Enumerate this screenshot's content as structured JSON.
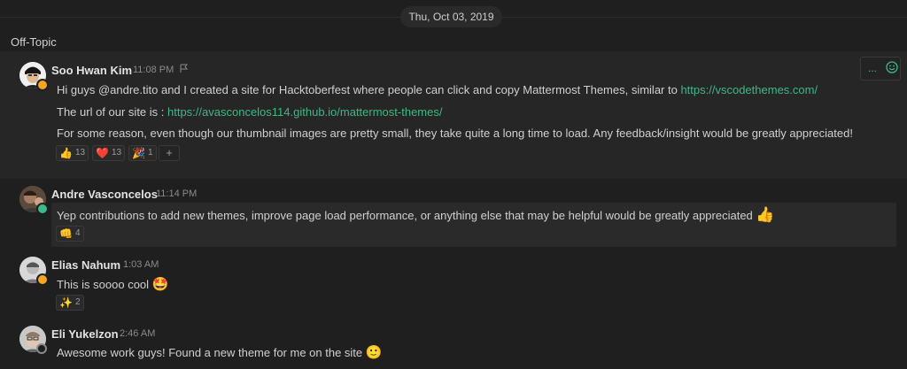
{
  "date_separator": "Thu, Oct 03, 2019",
  "channel": {
    "name": "Off-Topic"
  },
  "hover_actions": {
    "dots": "...",
    "emoji_icon": "smile-icon"
  },
  "posts": [
    {
      "author": "Soo Hwan Kim",
      "time": "11:08 PM",
      "status": "away",
      "lines": [
        {
          "text": "Hi guys @andre.tito and I created a site for Hacktoberfest where people can click and copy Mattermost Themes, similar to ",
          "link": "https://vscodethemes.com/"
        },
        {
          "text": "The url of our site is : ",
          "link": "https://avasconcelos114.github.io/mattermost-themes/"
        },
        {
          "text": "For some reason, even though our thumbnail images are pretty small, they take quite a long time to load. Any feedback/insight would be greatly appreciated!"
        }
      ],
      "reactions": [
        {
          "emoji": "👍",
          "count": "13"
        },
        {
          "emoji": "❤️",
          "count": "13"
        },
        {
          "emoji": "🎉",
          "count": "1"
        }
      ],
      "add_reaction": "+"
    },
    {
      "author": "Andre Vasconcelos",
      "time": "11:14 PM",
      "status": "online",
      "text": "Yep contributions to add new themes, improve page load performance, or anything else that may be helpful would be greatly appreciated",
      "text_emoji": "👍",
      "reactions": [
        {
          "emoji": "👊",
          "count": "4"
        }
      ]
    },
    {
      "author": "Elias Nahum",
      "time": "1:03 AM",
      "status": "away",
      "text": "This is soooo cool",
      "text_emoji": "🤩",
      "reactions": [
        {
          "emoji": "✨",
          "count": "2"
        }
      ]
    },
    {
      "author": "Eli Yukelzon",
      "time": "2:46 AM",
      "status": "offline",
      "text": "Awesome work guys! Found a new theme for me on the site",
      "text_emoji": "🙂"
    }
  ]
}
